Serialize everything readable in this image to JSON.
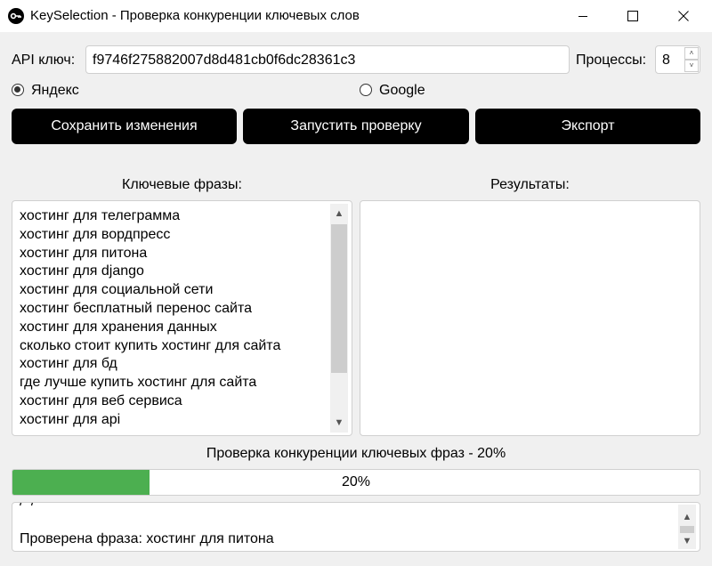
{
  "window": {
    "title": "KeySelection - Проверка конкуренции ключевых слов"
  },
  "settings": {
    "api_label": "API ключ:",
    "api_value": "f9746f275882007d8d481cb0f6dc28361c3",
    "processes_label": "Процессы:",
    "processes_value": "8"
  },
  "engines": {
    "yandex_label": "Яндекс",
    "google_label": "Google",
    "selected": "Яндекс"
  },
  "buttons": {
    "save": "Сохранить изменения",
    "run": "Запустить проверку",
    "export": "Экспорт"
  },
  "keywords": {
    "header": "Ключевые фразы:",
    "items": [
      "хостинг для телеграмма",
      "хостинг для вордпресс",
      "хостинг для питона",
      "хостинг для django",
      "хостинг для социальной сети",
      "хостинг бесплатный перенос сайта",
      "хостинг для хранения данных",
      "сколько стоит купить хостинг для сайта",
      "хостинг для бд",
      "где лучше купить хостинг для сайта",
      "хостинг для веб сервиса",
      "хостинг для api"
    ]
  },
  "results": {
    "header": "Результаты:"
  },
  "progress": {
    "status": "Проверка конкуренции ключевых фраз - 20%",
    "value": 0.2,
    "text": "20%",
    "color": "#4caf50"
  },
  "log": {
    "last_line": "Проверена фраза: хостинг для питона"
  }
}
